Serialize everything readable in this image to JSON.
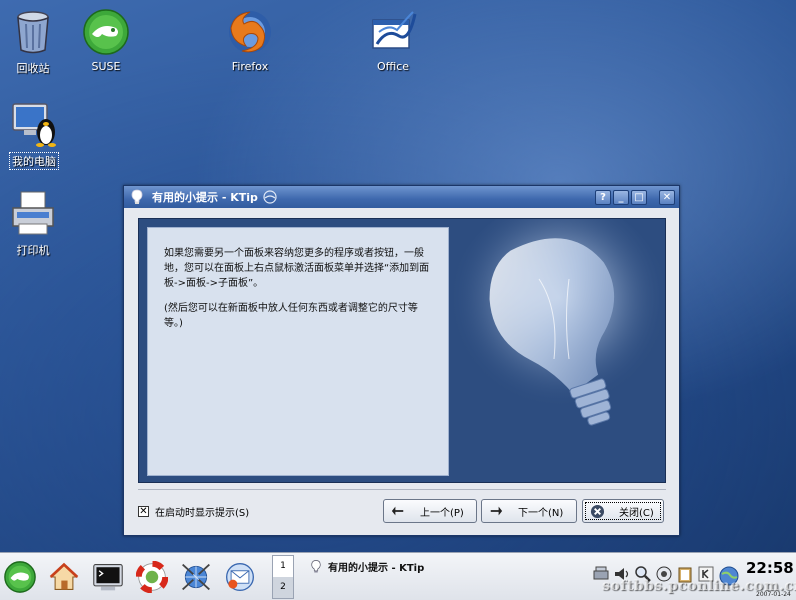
{
  "desktop": {
    "icons": [
      {
        "label": "回收站"
      },
      {
        "label": "SUSE"
      },
      {
        "label": "Firefox"
      },
      {
        "label": "Office"
      },
      {
        "label": "我的电脑"
      },
      {
        "label": "打印机"
      }
    ]
  },
  "dialog": {
    "title": "有用的小提示 - KTip",
    "title_buttons": [
      "?",
      "_",
      "□",
      "✕"
    ],
    "tip_paragraphs": [
      "如果您需要另一个面板来容纳您更多的程序或者按钮，一般地，您可以在面板上右点鼠标激活面板菜单并选择“添加到面板->面板->子面板”。",
      "(然后您可以在新面板中放人任何东西或者调整它的尺寸等等。)"
    ],
    "show_on_startup_label": "在启动时显示提示(S)",
    "show_on_startup_checked": true,
    "prev_button": "上一个(P)",
    "next_button": "下一个(N)",
    "close_button": "关闭(C)"
  },
  "taskbar": {
    "pager_pages": [
      "1",
      "2"
    ],
    "task_title": "有用的小提示 - KTip",
    "clock": "22:58",
    "date": "2007-01-24"
  },
  "watermark": "softbbs.pconline.com.cn"
}
